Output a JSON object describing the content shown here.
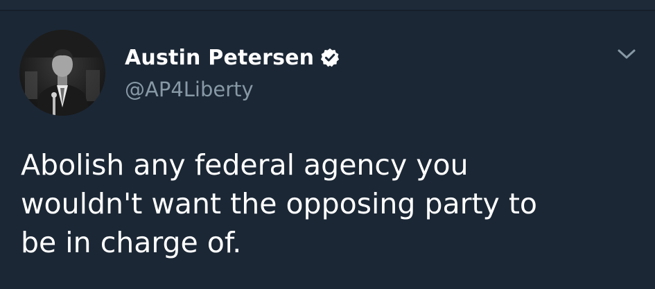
{
  "author": {
    "display_name": "Austin Petersen",
    "handle": "@AP4Liberty",
    "verified_icon": "verified-badge-icon",
    "avatar": "profile-photo"
  },
  "menu_icon": "chevron-down-icon",
  "tweet": {
    "lines": [
      "Abolish any federal agency you",
      "wouldn't want the opposing party to",
      "be in charge of."
    ]
  },
  "colors": {
    "background": "#1b2735",
    "text": "#ffffff",
    "handle": "#8899a6",
    "chevron": "#8899a6"
  }
}
